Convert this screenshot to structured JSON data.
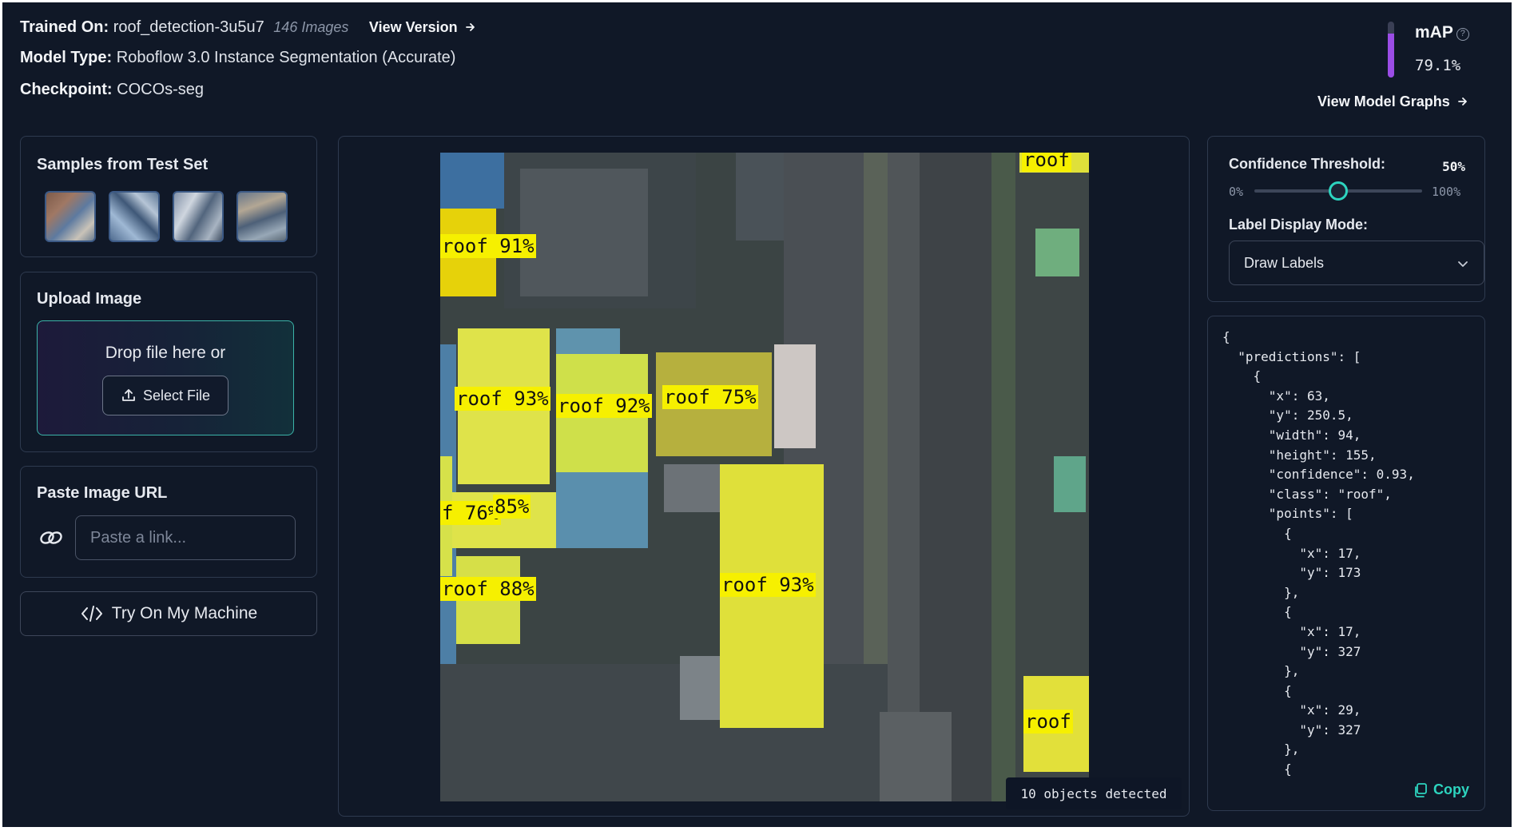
{
  "header": {
    "trained_on_label": "Trained On:",
    "trained_on_value": "roof_detection-3u5u7",
    "image_count": "146 Images",
    "view_version": "View Version",
    "model_type_label": "Model Type:",
    "model_type_value": "Roboflow 3.0 Instance Segmentation (Accurate)",
    "checkpoint_label": "Checkpoint:",
    "checkpoint_value": "COCOs-seg"
  },
  "metric": {
    "title": "mAP",
    "value": "79.1%",
    "value_fraction": 0.791,
    "accent": "#9b4de6",
    "view_graphs": "View Model Graphs"
  },
  "samples": {
    "title": "Samples from Test Set",
    "thumbnails": [
      "sample-1",
      "sample-2",
      "sample-3",
      "sample-4"
    ]
  },
  "upload": {
    "title": "Upload Image",
    "drop_text": "Drop file here or",
    "select_label": "Select File",
    "icon": "upload-icon"
  },
  "paste_url": {
    "title": "Paste Image URL",
    "placeholder": "Paste a link...",
    "icon": "link-icon"
  },
  "try_button": {
    "label": "Try On My Machine",
    "icon": "code-icon"
  },
  "detections": {
    "labels": [
      "roof",
      "roof 91%",
      "roof 93%",
      "roof 92%",
      "roof 75%",
      "f 76%",
      "85%",
      "roof 88%",
      "roof 93%",
      "roof"
    ],
    "objects_detected": "10 objects detected",
    "label_color": "#f6f000"
  },
  "controls": {
    "confidence_label": "Confidence Threshold:",
    "confidence_value": "50%",
    "confidence_fraction": 0.5,
    "min_label": "0%",
    "max_label": "100%",
    "display_mode_label": "Label Display Mode:",
    "display_mode_value": "Draw Labels",
    "accent": "#2dd4bf"
  },
  "json_output": {
    "text": "{\n  \"predictions\": [\n    {\n      \"x\": 63,\n      \"y\": 250.5,\n      \"width\": 94,\n      \"height\": 155,\n      \"confidence\": 0.93,\n      \"class\": \"roof\",\n      \"points\": [\n        {\n          \"x\": 17,\n          \"y\": 173\n        },\n        {\n          \"x\": 17,\n          \"y\": 327\n        },\n        {\n          \"x\": 29,\n          \"y\": 327\n        },\n        {",
    "copy_label": "Copy"
  }
}
